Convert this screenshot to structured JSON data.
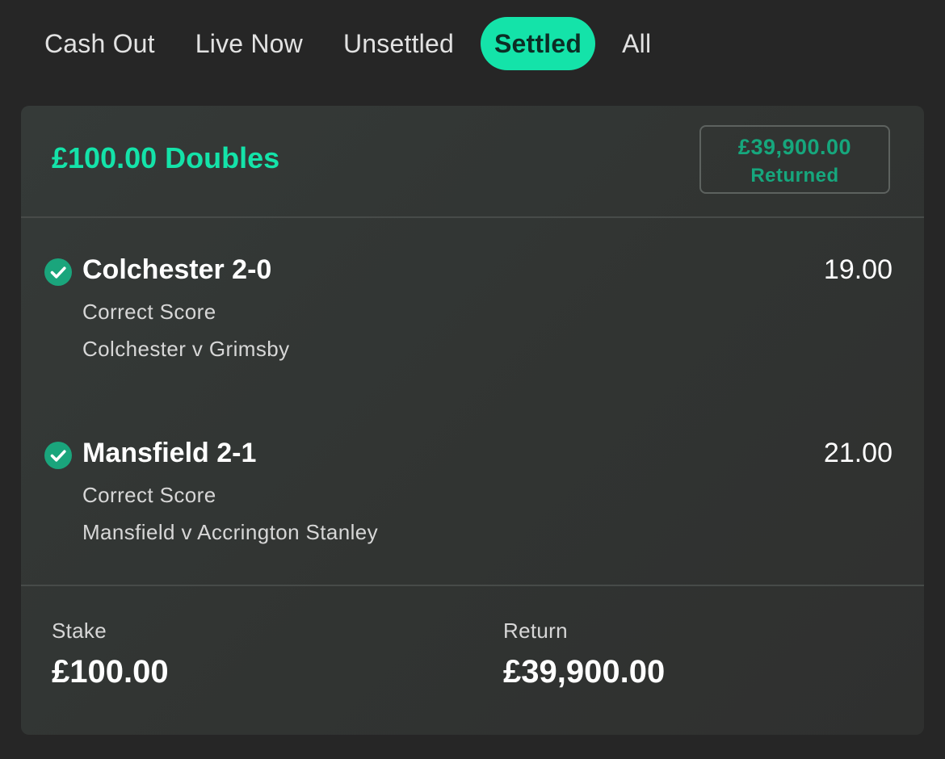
{
  "tabs": [
    {
      "label": "Cash Out",
      "active": false
    },
    {
      "label": "Live Now",
      "active": false
    },
    {
      "label": "Unsettled",
      "active": false
    },
    {
      "label": "Settled",
      "active": true
    },
    {
      "label": "All",
      "active": false
    }
  ],
  "bet": {
    "title": "£100.00 Doubles",
    "returned_amount": "£39,900.00",
    "returned_label": "Returned",
    "selections": [
      {
        "name": "Colchester 2-0",
        "market": "Correct Score",
        "event": "Colchester v Grimsby",
        "odds": "19.00",
        "status_icon": "check-circle-icon"
      },
      {
        "name": "Mansfield 2-1",
        "market": "Correct Score",
        "event": "Mansfield v Accrington Stanley",
        "odds": "21.00",
        "status_icon": "check-circle-icon"
      }
    ],
    "stake_label": "Stake",
    "stake_value": "£100.00",
    "return_label": "Return",
    "return_value": "£39,900.00"
  },
  "colors": {
    "accent": "#14e3a9",
    "win_green": "#1aa57c",
    "background": "#262626",
    "card": "#333735"
  }
}
